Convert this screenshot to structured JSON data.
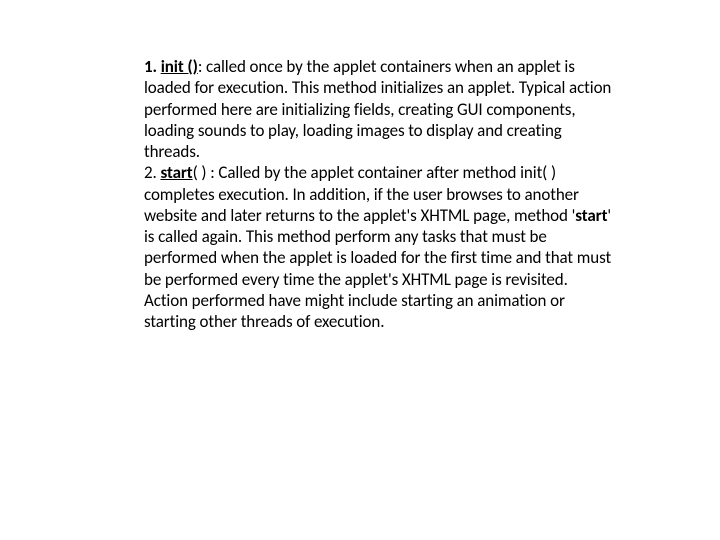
{
  "item1": {
    "num": "1. ",
    "name": "init ()",
    "desc": ": called once by the applet containers when an applet is loaded for execution. This method initializes an applet. Typical action performed here are initializing fields, creating GUI components, loading sounds to play, loading images to display and creating threads."
  },
  "item2": {
    "num": "2. ",
    "name": "start",
    "desc_a": "( ) : Called by the applet container after method init( ) completes execution. In addition, if the  user browses to another website and later returns to the applet's XHTML page, method '",
    "bold_inline": "start",
    "desc_b": "' is called again. This  method perform any tasks that must be performed when the applet is loaded for the first time and that must be performed every time the applet's XHTML page is revisited. Action performed have might include starting an animation or starting other threads of execution."
  }
}
